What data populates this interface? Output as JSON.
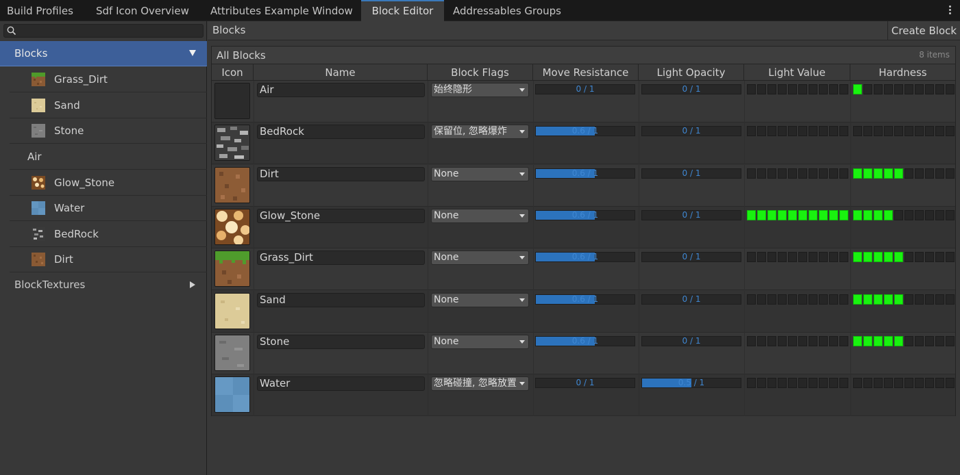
{
  "tabs": [
    {
      "label": "Build Profiles"
    },
    {
      "label": "Sdf Icon Overview"
    },
    {
      "label": "Attributes Example Window"
    },
    {
      "label": "Block Editor"
    },
    {
      "label": "Addressables Groups"
    }
  ],
  "sidebar": {
    "search_placeholder": "",
    "root_label": "Blocks",
    "items": [
      {
        "label": "Grass_Dirt",
        "icon": "grass-dirt-icon"
      },
      {
        "label": "Sand",
        "icon": "sand-icon"
      },
      {
        "label": "Stone",
        "icon": "stone-icon"
      },
      {
        "label": "Air",
        "icon": ""
      },
      {
        "label": "Glow_Stone",
        "icon": "glow-stone-icon"
      },
      {
        "label": "Water",
        "icon": "water-icon"
      },
      {
        "label": "BedRock",
        "icon": "bedrock-icon"
      },
      {
        "label": "Dirt",
        "icon": "dirt-icon"
      }
    ],
    "textures_label": "BlockTextures"
  },
  "main": {
    "title": "Blocks",
    "create_label": "Create Block",
    "list_title": "All Blocks",
    "item_count": "8 items",
    "columns": [
      "Icon",
      "Name",
      "Block Flags",
      "Move Resistance",
      "Light Opacity",
      "Light Value",
      "Hardness"
    ]
  },
  "rows": [
    {
      "name": "Air",
      "flags": "始终隐形",
      "move_resistance": 0,
      "move_label": "0 / 1",
      "light_opacity": 0,
      "opacity_label": "0 / 1",
      "light_value": 0,
      "hardness": 1
    },
    {
      "name": "BedRock",
      "flags": "保留位, 忽略爆炸",
      "move_resistance": 0.6,
      "move_label": "0.6 / 1",
      "light_opacity": 0,
      "opacity_label": "0 / 1",
      "light_value": 0,
      "hardness": 0
    },
    {
      "name": "Dirt",
      "flags": "None",
      "move_resistance": 0.6,
      "move_label": "0.6 / 1",
      "light_opacity": 0,
      "opacity_label": "0 / 1",
      "light_value": 0,
      "hardness": 5
    },
    {
      "name": "Glow_Stone",
      "flags": "None",
      "move_resistance": 0.6,
      "move_label": "0.6 / 1",
      "light_opacity": 0,
      "opacity_label": "0 / 1",
      "light_value": 10,
      "hardness": 4
    },
    {
      "name": "Grass_Dirt",
      "flags": "None",
      "move_resistance": 0.6,
      "move_label": "0.6 / 1",
      "light_opacity": 0,
      "opacity_label": "0 / 1",
      "light_value": 0,
      "hardness": 5
    },
    {
      "name": "Sand",
      "flags": "None",
      "move_resistance": 0.6,
      "move_label": "0.6 / 1",
      "light_opacity": 0,
      "opacity_label": "0 / 1",
      "light_value": 0,
      "hardness": 5
    },
    {
      "name": "Stone",
      "flags": "None",
      "move_resistance": 0.6,
      "move_label": "0.6 / 1",
      "light_opacity": 0,
      "opacity_label": "0 / 1",
      "light_value": 0,
      "hardness": 5
    },
    {
      "name": "Water",
      "flags": "忽略碰撞, 忽略放置",
      "move_resistance": 0,
      "move_label": "0 / 1",
      "light_opacity": 0.5,
      "opacity_label": "0.5 / 1",
      "light_value": 0,
      "hardness": 0
    }
  ],
  "colors": {
    "accent": "#3d5f99",
    "bar_fill": "#2c73bd",
    "segment_on": "#19f20f"
  }
}
